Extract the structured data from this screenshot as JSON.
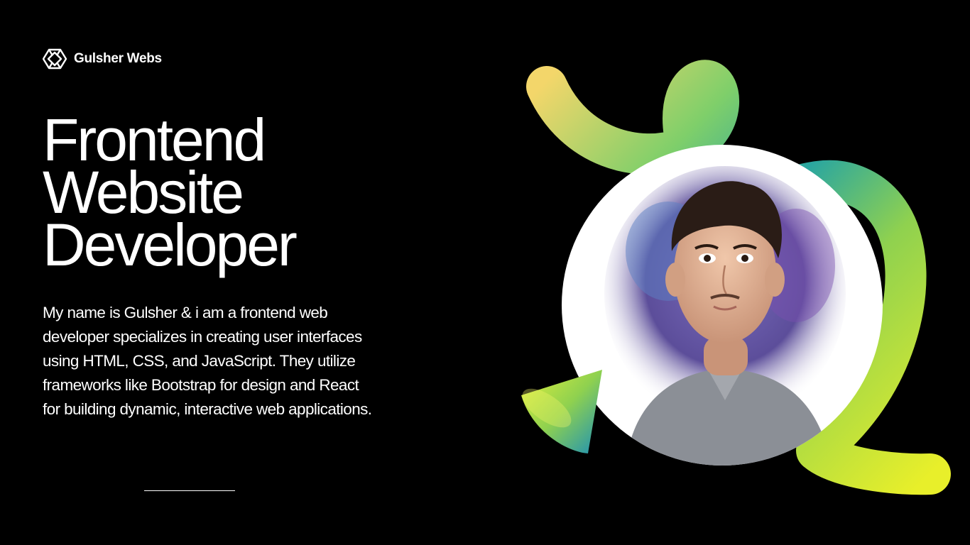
{
  "brand": {
    "name": "Gulsher Webs",
    "logo_icon": "diamond-logo-icon"
  },
  "hero": {
    "title_lines": [
      "Frontend",
      "Website",
      "Developer"
    ]
  },
  "bio": {
    "text": "My name is Gulsher & i am a frontend web developer specializes in creating user interfaces using HTML, CSS, and JavaScript. They utilize frameworks like Bootstrap for design and React for building dynamic, interactive web applications."
  },
  "decor": {
    "ribbon_icon": "gradient-ribbon-shape",
    "cone_icon": "gradient-cone-shape",
    "avatar_icon": "portrait-avatar"
  },
  "colors": {
    "background": "#000000",
    "text": "#ffffff",
    "gradient_yellow": "#e8ef2a",
    "gradient_green": "#8fd14f",
    "gradient_teal": "#1fa3a0"
  }
}
